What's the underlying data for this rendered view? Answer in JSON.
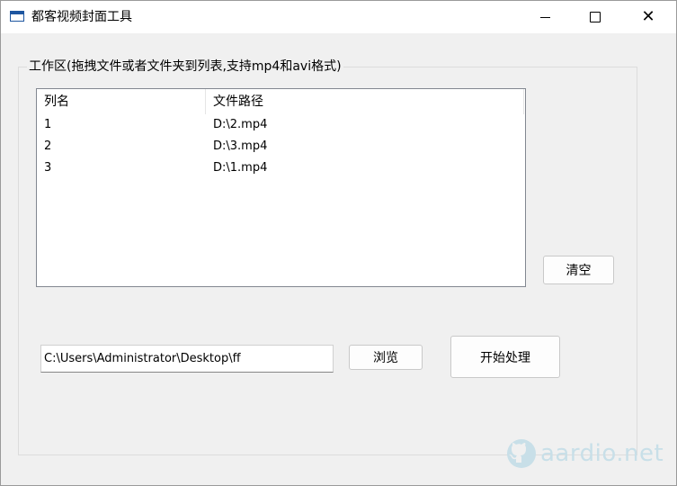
{
  "window": {
    "title": "都客视频封面工具"
  },
  "group": {
    "label": "工作区(拖拽文件或者文件夹到列表,支持mp4和avi格式)"
  },
  "list": {
    "columns": [
      "列名",
      "文件路径"
    ],
    "rows": [
      {
        "name": "1",
        "path": "D:\\2.mp4"
      },
      {
        "name": "2",
        "path": "D:\\3.mp4"
      },
      {
        "name": "3",
        "path": "D:\\1.mp4"
      }
    ]
  },
  "buttons": {
    "clear": "清空",
    "browse": "浏览",
    "start": "开始处理"
  },
  "path_input": {
    "value": "C:\\Users\\Administrator\\Desktop\\ff"
  },
  "watermark": {
    "text": "aardio.net"
  }
}
